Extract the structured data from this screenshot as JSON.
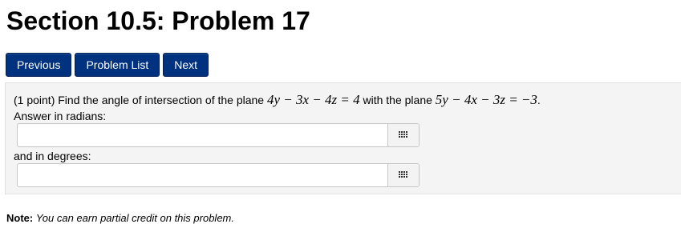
{
  "page": {
    "title": "Section 10.5: Problem 17"
  },
  "nav": {
    "previous": "Previous",
    "problem_list": "Problem List",
    "next": "Next"
  },
  "problem": {
    "points": "(1 point)",
    "text_before": "Find the angle of intersection of the plane",
    "plane1": "4y − 3x − 4z = 4",
    "text_middle": "with the plane",
    "plane2": "5y − 4x − 3z = −3",
    "text_end": ".",
    "radians_label": "Answer in radians:",
    "degrees_label": "and in degrees:",
    "radians_value": "",
    "degrees_value": ""
  },
  "note": {
    "label": "Note:",
    "text": "You can earn partial credit on this problem."
  },
  "icons": {
    "keypad": "keypad-grid-icon"
  }
}
